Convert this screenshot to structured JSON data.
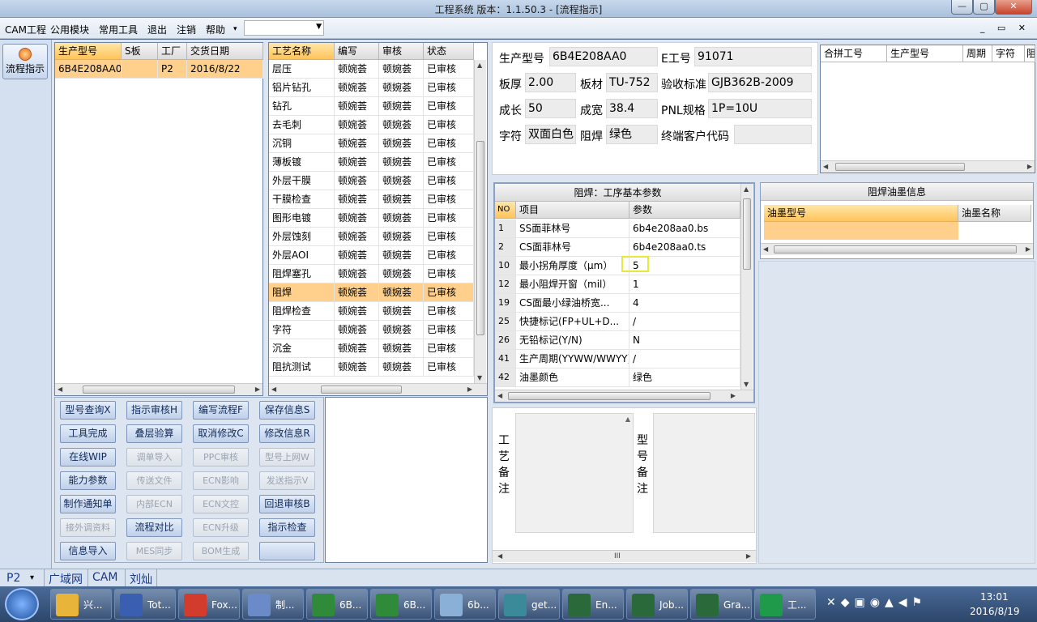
{
  "window": {
    "title": "工程系统  版本：1.1.50.3 - [流程指示]",
    "min": "—",
    "restore": "▢",
    "close": "✕"
  },
  "menu": {
    "items": [
      "CAM工程",
      "公用模块",
      "常用工具",
      "退出",
      "注销",
      "帮助"
    ],
    "help_arrow": "▾",
    "combo_value": "",
    "mdi": "_ ▭ ✕"
  },
  "nav": {
    "label": "流程指示"
  },
  "product_table": {
    "headers": [
      "生产型号",
      "S板",
      "工厂",
      "交货日期"
    ],
    "rows": [
      [
        "6B4E208AA0",
        "",
        "P2",
        "2016/8/22"
      ]
    ]
  },
  "process_table": {
    "headers": [
      "工艺名称",
      "编写",
      "审核",
      "状态"
    ],
    "rows": [
      [
        "层压",
        "顿婉荟",
        "顿婉荟",
        "已审核"
      ],
      [
        "铝片钻孔",
        "顿婉荟",
        "顿婉荟",
        "已审核"
      ],
      [
        "钻孔",
        "顿婉荟",
        "顿婉荟",
        "已审核"
      ],
      [
        "去毛刺",
        "顿婉荟",
        "顿婉荟",
        "已审核"
      ],
      [
        "沉铜",
        "顿婉荟",
        "顿婉荟",
        "已审核"
      ],
      [
        "薄板镀",
        "顿婉荟",
        "顿婉荟",
        "已审核"
      ],
      [
        "外层干膜",
        "顿婉荟",
        "顿婉荟",
        "已审核"
      ],
      [
        "干膜检查",
        "顿婉荟",
        "顿婉荟",
        "已审核"
      ],
      [
        "图形电镀",
        "顿婉荟",
        "顿婉荟",
        "已审核"
      ],
      [
        "外层蚀刻",
        "顿婉荟",
        "顿婉荟",
        "已审核"
      ],
      [
        "外层AOI",
        "顿婉荟",
        "顿婉荟",
        "已审核"
      ],
      [
        "阻焊塞孔",
        "顿婉荟",
        "顿婉荟",
        "已审核"
      ],
      [
        "阻焊",
        "顿婉荟",
        "顿婉荟",
        "已审核"
      ],
      [
        "阻焊检查",
        "顿婉荟",
        "顿婉荟",
        "已审核"
      ],
      [
        "字符",
        "顿婉荟",
        "顿婉荟",
        "已审核"
      ],
      [
        "沉金",
        "顿婉荟",
        "顿婉荟",
        "已审核"
      ],
      [
        "阻抗测试",
        "顿婉荟",
        "顿婉荟",
        "已审核"
      ]
    ],
    "selected_index": 12
  },
  "buttons": [
    [
      "型号查询X",
      "指示审核H",
      "编写流程F",
      "保存信息S"
    ],
    [
      "工具完成",
      "叠层验算",
      "取消修改C",
      "修改信息R"
    ],
    [
      "在线WIP",
      "调单导入",
      "PPC审核",
      "型号上网W"
    ],
    [
      "能力参数",
      "传送文件",
      "ECN影响",
      "发送指示V"
    ],
    [
      "制作通知单",
      "内部ECN",
      "ECN文控",
      "回退审核B"
    ],
    [
      "接外调资料",
      "流程对比",
      "ECN升级",
      "指示检查"
    ],
    [
      "信息导入",
      "MES同步",
      "BOM生成",
      ""
    ]
  ],
  "buttons_disabled": [
    [
      false,
      false,
      false,
      false
    ],
    [
      false,
      false,
      false,
      false
    ],
    [
      false,
      true,
      true,
      true
    ],
    [
      false,
      true,
      true,
      true
    ],
    [
      false,
      true,
      true,
      false
    ],
    [
      true,
      false,
      true,
      false
    ],
    [
      false,
      true,
      true,
      false
    ]
  ],
  "info": {
    "rows": [
      [
        {
          "label": "生产型号",
          "value": "6B4E208AA0"
        },
        {
          "label": "E工号",
          "value": "91071"
        }
      ],
      [
        {
          "label": "板厚",
          "value": "2.00"
        },
        {
          "label": "板材",
          "value": "TU-752"
        },
        {
          "label": "验收标准",
          "value": "GJB362B-2009"
        }
      ],
      [
        {
          "label": "成长",
          "value": "50"
        },
        {
          "label": "成宽",
          "value": "38.4"
        },
        {
          "label": "PNL规格",
          "value": "1P=10U"
        }
      ],
      [
        {
          "label": "字符",
          "value": "双面白色"
        },
        {
          "label": "阻焊",
          "value": "绿色"
        },
        {
          "label": "终端客户代码",
          "value": ""
        }
      ]
    ]
  },
  "merge_table": {
    "headers": [
      "合拼工号",
      "生产型号",
      "周期",
      "字符",
      "阻"
    ]
  },
  "params": {
    "title": "阻焊：工序基本参数",
    "headers": [
      "NO",
      "项目",
      "参数"
    ],
    "rows": [
      [
        "1",
        "SS面菲林号",
        "6b4e208aa0.bs"
      ],
      [
        "2",
        "CS面菲林号",
        "6b4e208aa0.ts"
      ],
      [
        "10",
        "最小拐角厚度（μm）",
        "5"
      ],
      [
        "12",
        "最小阻焊开窗（mil）",
        "1"
      ],
      [
        "19",
        "CS面最小绿油桥宽...",
        "4"
      ],
      [
        "25",
        "快捷标记(FP+UL+D...",
        "/"
      ],
      [
        "26",
        "无铅标记(Y/N)",
        "N"
      ],
      [
        "41",
        "生产周期(YYWW/WWYY)",
        "/"
      ],
      [
        "42",
        "油墨颜色",
        "绿色"
      ]
    ]
  },
  "ink": {
    "title": "阻焊油墨信息",
    "headers": [
      "油墨型号",
      "油墨名称"
    ]
  },
  "notes": {
    "process_label": "工\n艺\n备\n注",
    "model_label": "型\n号\n备\n注",
    "grip": "III"
  },
  "status": {
    "factory": "P2",
    "arrow": "▾",
    "items": [
      "广域网",
      "CAM",
      "刘灿"
    ]
  },
  "taskbar": {
    "tasks": [
      "兴...",
      "Tot...",
      "Fox...",
      "制...",
      "6B...",
      "6B...",
      "6b...",
      "get...",
      "En...",
      "Job...",
      "Gra...",
      "工..."
    ],
    "time": "13:01",
    "date": "2016/8/19"
  },
  "colors": {
    "accent": "#ffc35c",
    "selected_row": "#ffd08b",
    "highlight_box": "#e8e83a"
  }
}
